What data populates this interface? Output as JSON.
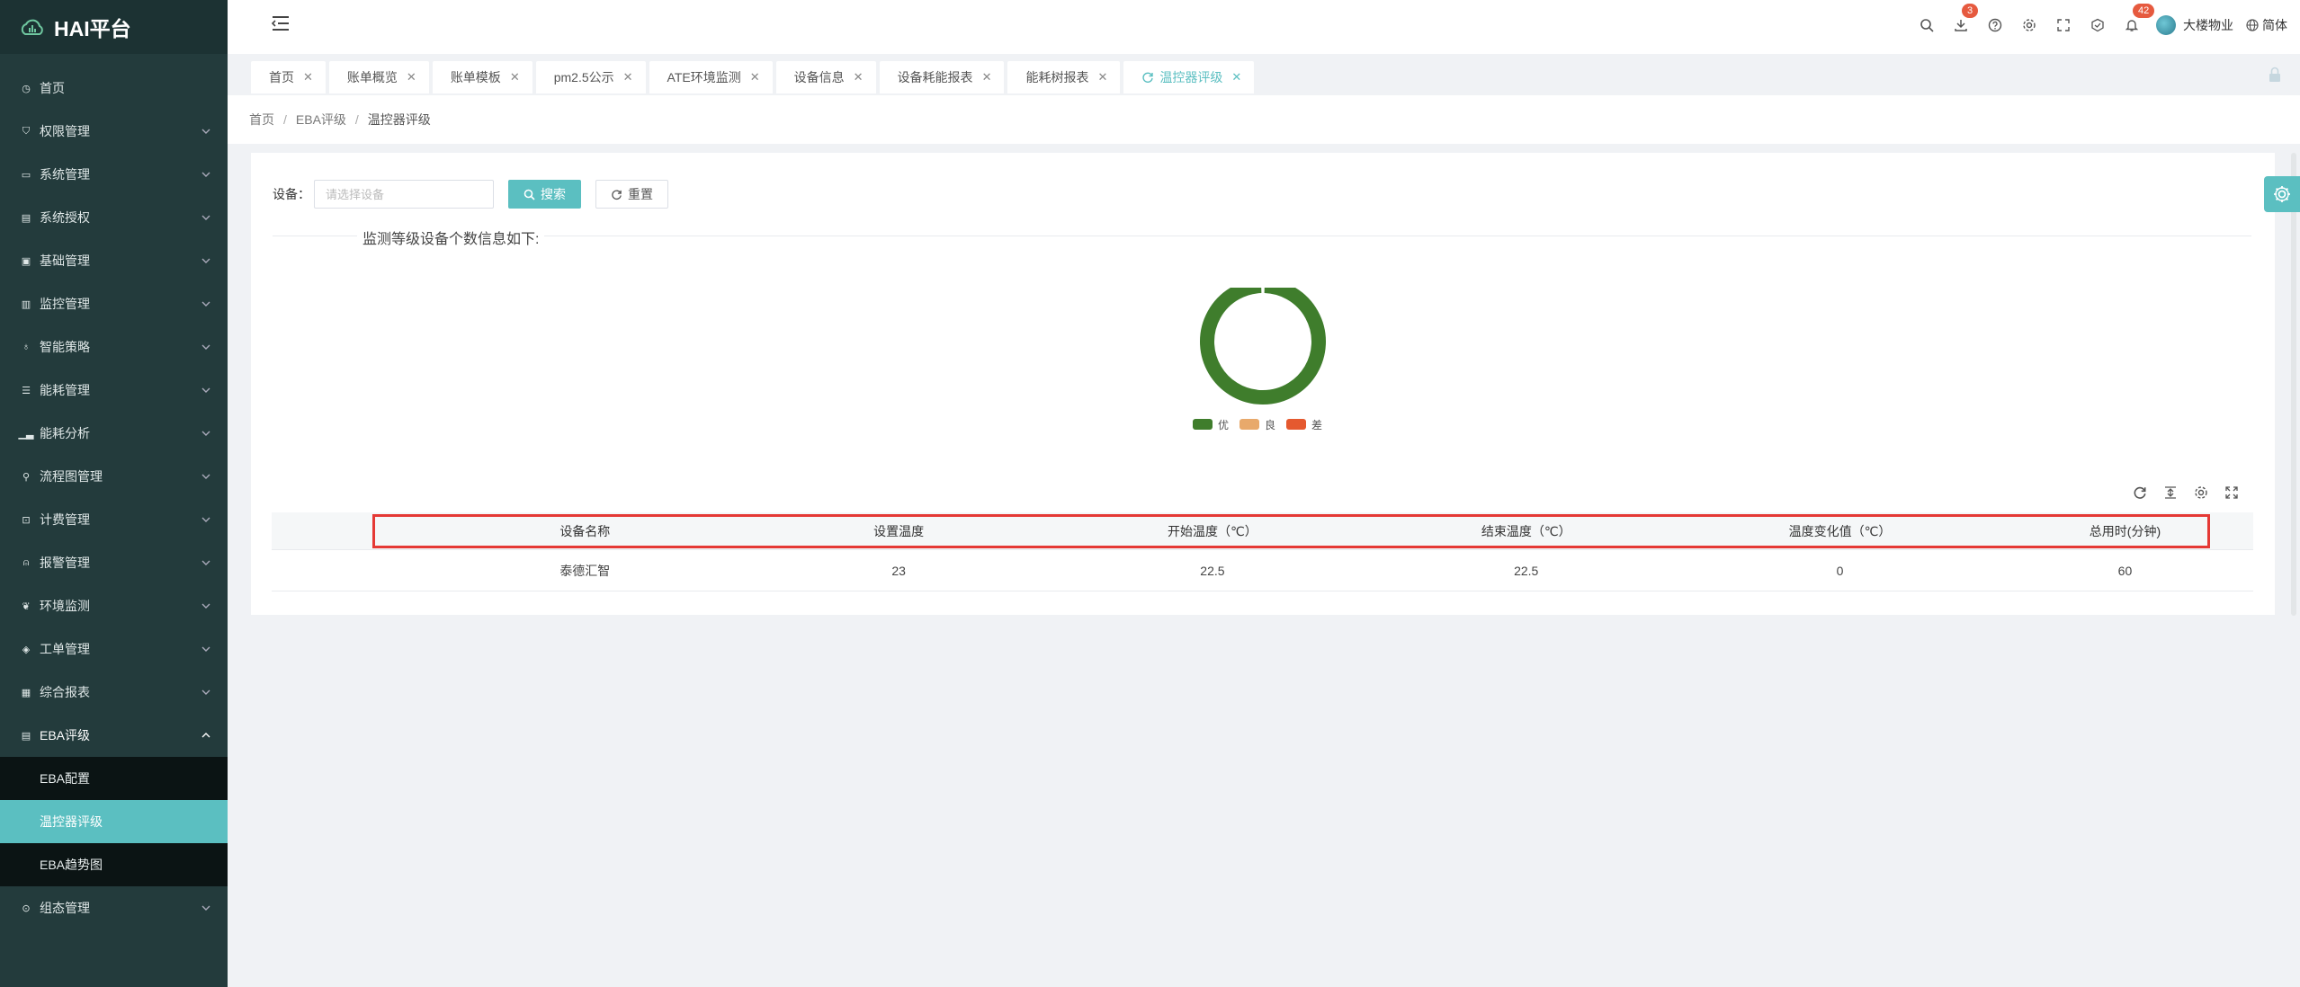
{
  "app": {
    "title": "HAI平台"
  },
  "sidebar": {
    "items": [
      {
        "label": "首页",
        "icon": "dashboard-icon"
      },
      {
        "label": "权限管理",
        "icon": "shield-icon"
      },
      {
        "label": "系统管理",
        "icon": "monitor-icon"
      },
      {
        "label": "系统授权",
        "icon": "license-icon"
      },
      {
        "label": "基础管理",
        "icon": "data-icon"
      },
      {
        "label": "监控管理",
        "icon": "monitor-icon"
      },
      {
        "label": "智能策略",
        "icon": "bulb-icon"
      },
      {
        "label": "能耗管理",
        "icon": "sliders-icon"
      },
      {
        "label": "能耗分析",
        "icon": "bar-chart-icon"
      },
      {
        "label": "流程图管理",
        "icon": "flow-icon"
      },
      {
        "label": "计费管理",
        "icon": "money-icon"
      },
      {
        "label": "报警管理",
        "icon": "alarm-icon"
      },
      {
        "label": "环境监测",
        "icon": "leaf-icon"
      },
      {
        "label": "工单管理",
        "icon": "order-icon"
      },
      {
        "label": "综合报表",
        "icon": "report-icon"
      }
    ],
    "open_group": {
      "label": "EBA评级",
      "children": [
        {
          "label": "EBA配置"
        },
        {
          "label": "温控器评级"
        },
        {
          "label": "EBA趋势图"
        }
      ]
    },
    "after": [
      {
        "label": "组态管理",
        "icon": "config-icon"
      }
    ]
  },
  "header": {
    "download_badge": "3",
    "notify_badge": "42",
    "user_name": "大楼物业",
    "lang": "简体"
  },
  "tabs": [
    {
      "label": "首页"
    },
    {
      "label": "账单概览"
    },
    {
      "label": "账单模板"
    },
    {
      "label": "pm2.5公示"
    },
    {
      "label": "ATE环境监测"
    },
    {
      "label": "设备信息"
    },
    {
      "label": "设备耗能报表"
    },
    {
      "label": "能耗树报表"
    },
    {
      "label": "温控器评级"
    }
  ],
  "breadcrumb": [
    "首页",
    "EBA评级",
    "温控器评级"
  ],
  "search": {
    "label": "设备：",
    "placeholder": "请选择设备",
    "search_btn": "搜索",
    "reset_btn": "重置"
  },
  "section_title": "监测等级设备个数信息如下:",
  "chart_data": {
    "type": "pie",
    "categories": [
      "优",
      "良",
      "差"
    ],
    "values": [
      1,
      0,
      0
    ],
    "colors": [
      "#3f7d2c",
      "#e8a96b",
      "#e5592f"
    ],
    "legend": "bottom"
  },
  "table": {
    "columns": [
      "设备名称",
      "设置温度",
      "开始温度（℃）",
      "结束温度（℃）",
      "温度变化值（℃）",
      "总用时(分钟)"
    ],
    "rows": [
      [
        "泰德汇智",
        "23",
        "22.5",
        "22.5",
        "0",
        "60"
      ]
    ]
  }
}
